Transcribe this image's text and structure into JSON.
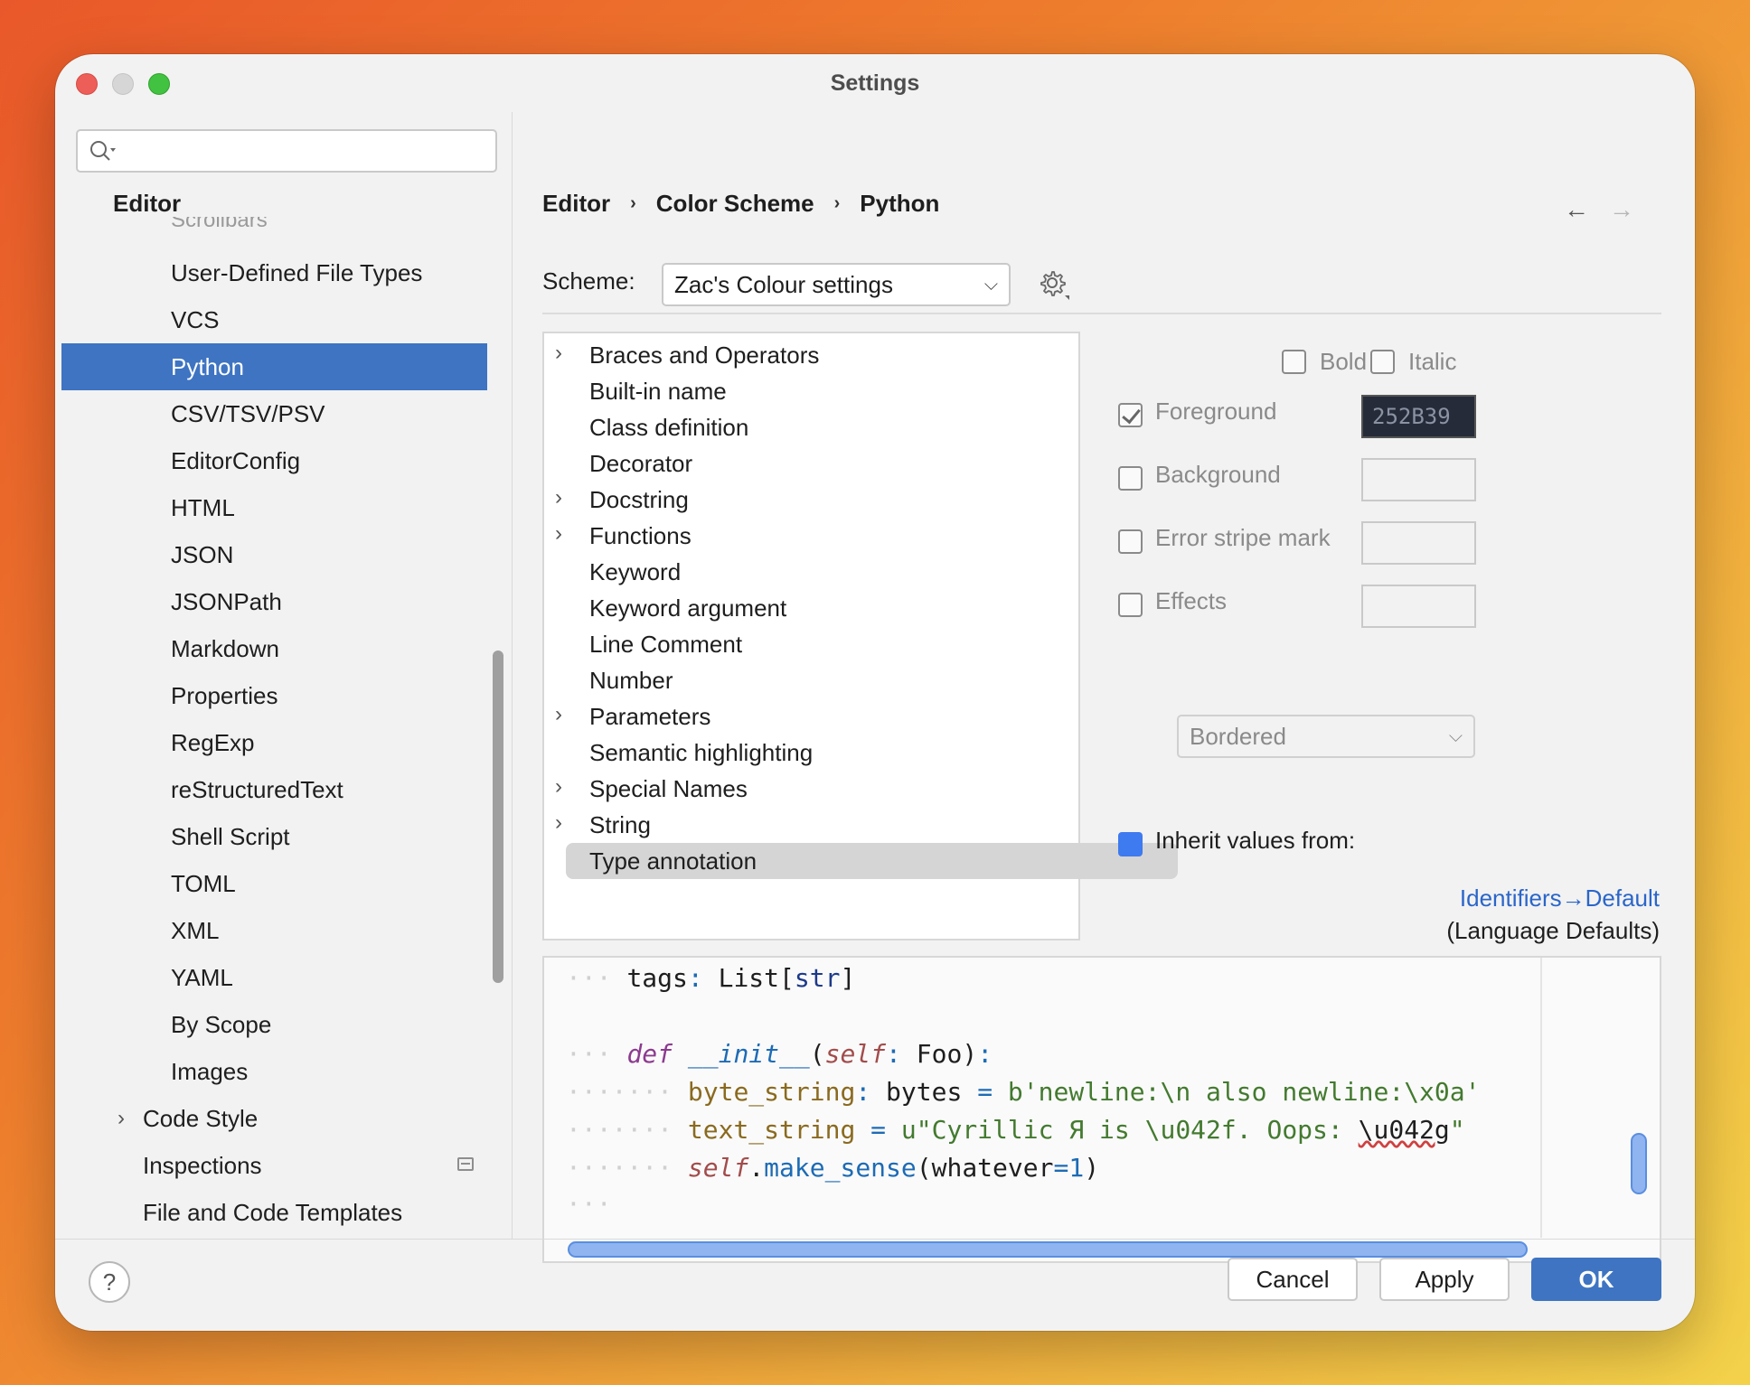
{
  "window": {
    "title": "Settings"
  },
  "sidebar": {
    "search_placeholder": "",
    "header": "Editor",
    "ghost_item": "Scrollbars",
    "items": [
      {
        "label": "User-Defined File Types",
        "level": 2,
        "selected": false
      },
      {
        "label": "VCS",
        "level": 2,
        "selected": false
      },
      {
        "label": "Python",
        "level": 2,
        "selected": true
      },
      {
        "label": "CSV/TSV/PSV",
        "level": 2,
        "selected": false
      },
      {
        "label": "EditorConfig",
        "level": 2,
        "selected": false
      },
      {
        "label": "HTML",
        "level": 2,
        "selected": false
      },
      {
        "label": "JSON",
        "level": 2,
        "selected": false
      },
      {
        "label": "JSONPath",
        "level": 2,
        "selected": false
      },
      {
        "label": "Markdown",
        "level": 2,
        "selected": false
      },
      {
        "label": "Properties",
        "level": 2,
        "selected": false
      },
      {
        "label": "RegExp",
        "level": 2,
        "selected": false
      },
      {
        "label": "reStructuredText",
        "level": 2,
        "selected": false
      },
      {
        "label": "Shell Script",
        "level": 2,
        "selected": false
      },
      {
        "label": "TOML",
        "level": 2,
        "selected": false
      },
      {
        "label": "XML",
        "level": 2,
        "selected": false
      },
      {
        "label": "YAML",
        "level": 2,
        "selected": false
      },
      {
        "label": "By Scope",
        "level": 2,
        "selected": false
      },
      {
        "label": "Images",
        "level": 2,
        "selected": false
      },
      {
        "label": "Code Style",
        "level": 1,
        "selected": false,
        "expandable": true
      },
      {
        "label": "Inspections",
        "level": 1,
        "selected": false,
        "has_icon": true
      },
      {
        "label": "File and Code Templates",
        "level": 1,
        "selected": false
      }
    ]
  },
  "breadcrumb": [
    "Editor",
    "Color Scheme",
    "Python"
  ],
  "breadcrumb_separator": "›",
  "nav": {
    "back": "←",
    "forward": "→"
  },
  "scheme": {
    "label": "Scheme:",
    "value": "Zac's Colour settings"
  },
  "tree": {
    "items": [
      {
        "label": "Braces and Operators",
        "expandable": true
      },
      {
        "label": "Built-in name",
        "expandable": false
      },
      {
        "label": "Class definition",
        "expandable": false
      },
      {
        "label": "Decorator",
        "expandable": false
      },
      {
        "label": "Docstring",
        "expandable": true
      },
      {
        "label": "Functions",
        "expandable": true
      },
      {
        "label": "Keyword",
        "expandable": false
      },
      {
        "label": "Keyword argument",
        "expandable": false
      },
      {
        "label": "Line Comment",
        "expandable": false
      },
      {
        "label": "Number",
        "expandable": false
      },
      {
        "label": "Parameters",
        "expandable": true
      },
      {
        "label": "Semantic highlighting",
        "expandable": false
      },
      {
        "label": "Special Names",
        "expandable": true
      },
      {
        "label": "String",
        "expandable": true
      },
      {
        "label": "Type annotation",
        "expandable": false,
        "selected": true
      }
    ]
  },
  "properties": {
    "bold_label": "Bold",
    "italic_label": "Italic",
    "foreground_label": "Foreground",
    "foreground_checked": true,
    "foreground_value": "252B39",
    "background_label": "Background",
    "error_stripe_label": "Error stripe mark",
    "effects_label": "Effects",
    "effects_type": "Bordered",
    "inherit_label": "Inherit values from:",
    "inherit_link": "Identifiers→Default",
    "inherit_sub": "(Language Defaults)"
  },
  "preview": {
    "lines": [
      "tags: List[str]",
      "",
      "def __init__(self: Foo):",
      "byte_string: bytes = b'newline:\\n also newline:\\x0a'",
      "text_string = u\"Cyrillic Я is \\u042f. Oops: \\u042g\"",
      "self.make_sense(whatever=1)"
    ]
  },
  "footer": {
    "help": "?",
    "cancel": "Cancel",
    "apply": "Apply",
    "ok": "OK"
  }
}
